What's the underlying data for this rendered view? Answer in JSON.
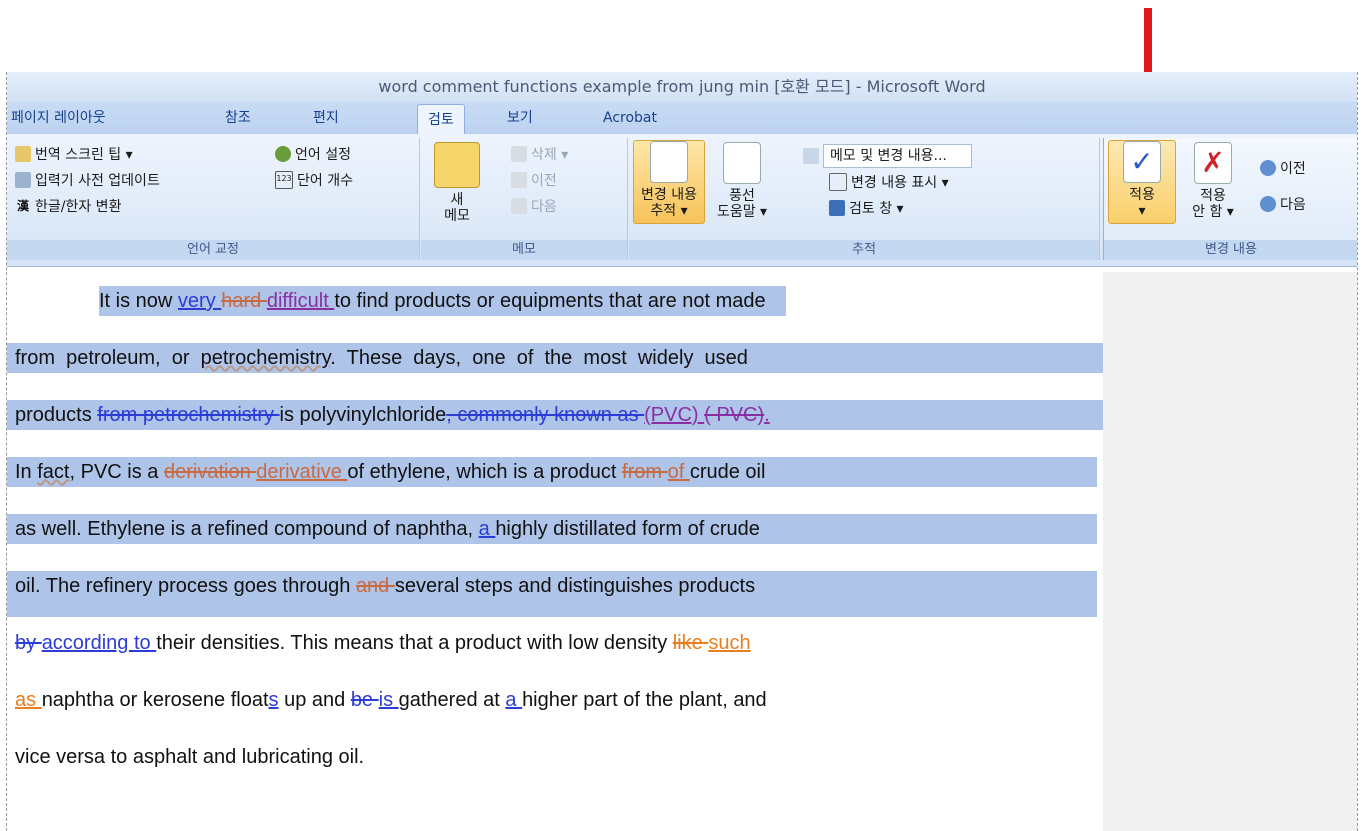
{
  "window": {
    "title": "word comment functions example from jung min [호환 모드] - Microsoft Word"
  },
  "tabs": [
    "페이지 레이아웃",
    "참조",
    "편지",
    "검토",
    "보기",
    "Acrobat"
  ],
  "ribbon": {
    "proofing": {
      "label": "언어 교정",
      "translate_tip": "번역 스크린 팁 ▾",
      "ime_update": "입력기 사전 업데이트",
      "hanja": "한글/한자 변환",
      "language": "언어 설정",
      "word_count": "단어 개수"
    },
    "comments": {
      "label": "메모",
      "new_comment_1": "새",
      "new_comment_2": "메모",
      "delete": "삭제 ▾",
      "prev": "이전",
      "next": "다음"
    },
    "tracking": {
      "label": "추적",
      "track_changes_1": "변경 내용",
      "track_changes_2": "추적 ▾",
      "balloons_1": "풍선",
      "balloons_2": "도움말 ▾",
      "markup_select": "메모 및 변경 내용...",
      "show_markup": "변경 내용 표시 ▾",
      "review_pane": "검토 창 ▾"
    },
    "changes": {
      "label": "변경 내용",
      "accept_1": "적용",
      "accept_2": "▾",
      "reject_1": "적용",
      "reject_2": "안 함 ▾",
      "prev": "이전",
      "next": "다음"
    }
  },
  "document": {
    "l1": {
      "a": "It is now ",
      "b": "very ",
      "c": "hard ",
      "d": "difficult ",
      "e": "to find products or equipments that are not made"
    },
    "l2": {
      "a": "from  petroleum,  or  ",
      "b": "petrochemistry",
      "c": ".  These  days,  one  of  the  most  widely  used"
    },
    "l3": {
      "a": "products ",
      "b": "from petrochemistry ",
      "c": "is polyvinylchloride",
      "d": ", commonly known as ",
      "e": "(PVC) ",
      "f": "( PVC)",
      "g": "."
    },
    "l4": {
      "a": "In ",
      "b": "fact",
      "c": ", PVC is a ",
      "d": "derivation ",
      "e": "derivative ",
      "f": "of ethylene, which is a product ",
      "g": "from ",
      "h": "of ",
      "i": "crude oil"
    },
    "l5": {
      "a": "as well. Ethylene is a refined compound of naphtha, ",
      "b": "a ",
      "c": "highly distillated form of crude"
    },
    "l6": {
      "a": "oil. The refinery process goes through ",
      "b": "and ",
      "c": "several steps and distinguishes products"
    },
    "l7": {
      "a": "by ",
      "b": "according to ",
      "c": "their densities. This means that a product with low density ",
      "d": "like ",
      "e": "such"
    },
    "l8": {
      "a": "as ",
      "b": "naphtha or kerosene float",
      "c": "s",
      "d": " up and ",
      "e": "be ",
      "f": "is ",
      "g": "gathered at ",
      "h": "a ",
      "i": "higher part of the plant, and"
    },
    "l9": {
      "a": "vice versa to asphalt and lubricating oil."
    }
  },
  "colors": {
    "selection": "#aec4e8",
    "arrow": "#e0181b",
    "insert_blue": "#2c3cd6",
    "insert_purple": "#8a2fa3",
    "insert_brown": "#c86a42",
    "insert_orange": "#e87e1f"
  }
}
